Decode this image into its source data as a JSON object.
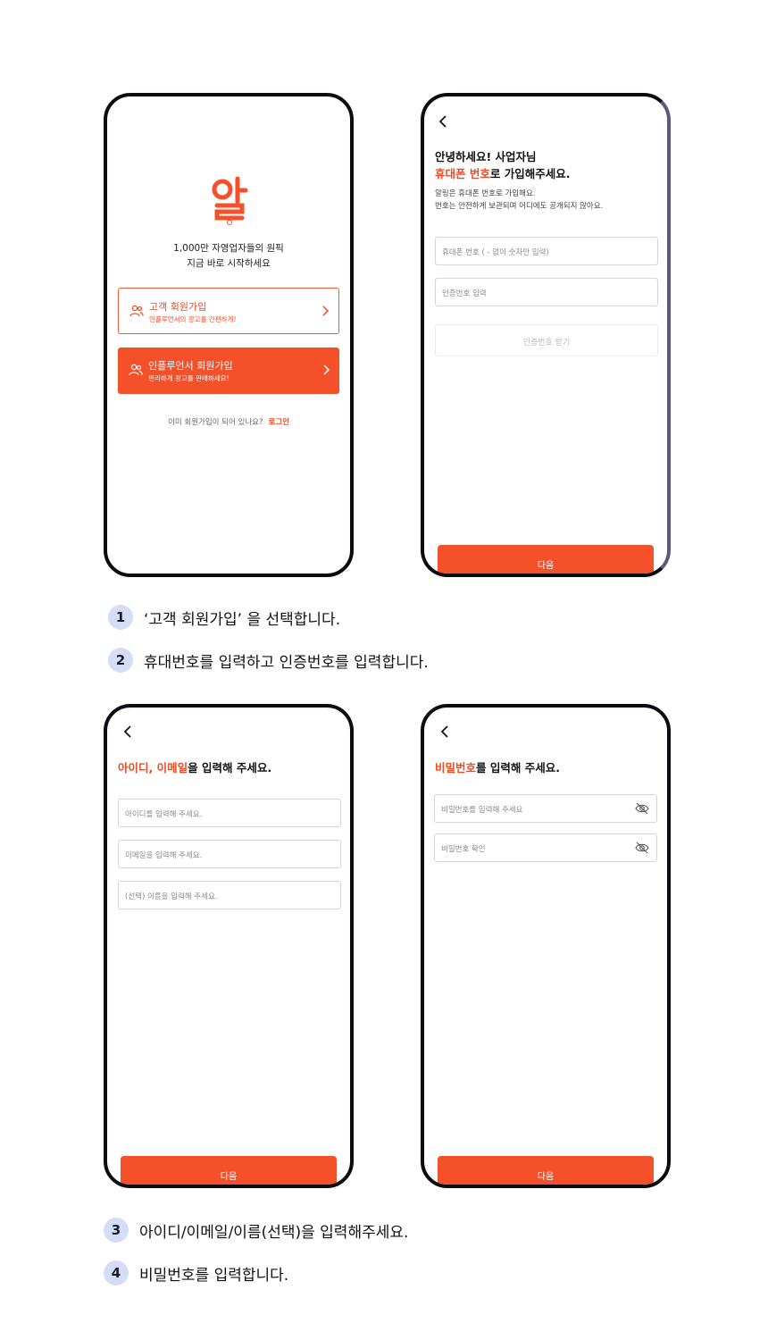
{
  "colors": {
    "accent": "#f4502a",
    "frame": "#0b0b12",
    "step_badge": "#d4dcf6"
  },
  "screen1": {
    "logo_icon": "app-logo",
    "tagline_1": "1,000만 자영업자들의 원픽",
    "tagline_2": "지금 바로 시작하세요",
    "customer": {
      "title": "고객 회원가입",
      "subtitle": "인플루언서의 광고를 간편하게!"
    },
    "influencer": {
      "title": "인플루언서 회원가입",
      "subtitle": "편리하게 광고를 판매하세요!"
    },
    "login_prompt": "이미 회원가입이 되어 있나요?",
    "login_link": "로그인"
  },
  "screen2": {
    "greeting": "안녕하세요! 사업자님",
    "heading_accent": "휴대폰 번호",
    "heading_rest": "로 가입해주세요.",
    "desc_1": "알링은 휴대폰 번호로 가입해요.",
    "desc_2": "번호는 안전하게 보관되며 어디에도 공개되지 않아요.",
    "phone_placeholder": "휴대폰 번호 ( - 없이 숫자만 입력)",
    "code_placeholder": "인증번호 입력",
    "get_code_button": "인증번호 받기",
    "next_button": "다음"
  },
  "screen3": {
    "heading_accent": "아이디, 이메일",
    "heading_rest": "을 입력해 주세요.",
    "id_placeholder": "아이디를 입력해 주세요.",
    "email_placeholder": "이메일을 입력해 주세요.",
    "name_placeholder": "(선택) 이름을 입력해 주세요.",
    "next_button": "다음"
  },
  "screen4": {
    "heading_accent": "비밀번호",
    "heading_rest": "를 입력해 주세요.",
    "password_placeholder": "비밀번호를 입력해 주세요",
    "confirm_placeholder": "비밀번호 확인",
    "next_button": "다음"
  },
  "steps": [
    {
      "num": "1",
      "text": "‘고객 회원가입’ 을 선택합니다."
    },
    {
      "num": "2",
      "text": "휴대번호를 입력하고 인증번호를 입력합니다."
    },
    {
      "num": "3",
      "text": "아이디/이메일/이름(선택)을 입력해주세요."
    },
    {
      "num": "4",
      "text": "비밀번호를 입력합니다."
    }
  ]
}
